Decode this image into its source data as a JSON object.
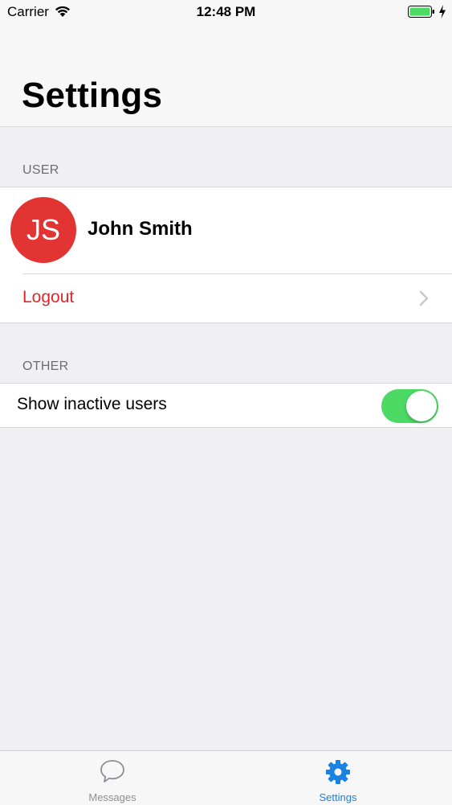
{
  "status_bar": {
    "carrier": "Carrier",
    "time": "12:48 PM"
  },
  "header": {
    "title": "Settings"
  },
  "sections": {
    "user": {
      "header": "USER",
      "avatar_initials": "JS",
      "avatar_color": "#e23433",
      "name": "John Smith",
      "logout_label": "Logout",
      "logout_color": "#e0272a"
    },
    "other": {
      "header": "OTHER",
      "show_inactive_label": "Show inactive users",
      "show_inactive_on": true,
      "toggle_color": "#4cd964"
    }
  },
  "tab_bar": {
    "tabs": [
      {
        "label": "Messages",
        "icon": "speech-bubble-icon",
        "active": false
      },
      {
        "label": "Settings",
        "icon": "gear-icon",
        "active": true
      }
    ],
    "active_color": "#1a82e0",
    "inactive_color": "#8e8e93"
  }
}
